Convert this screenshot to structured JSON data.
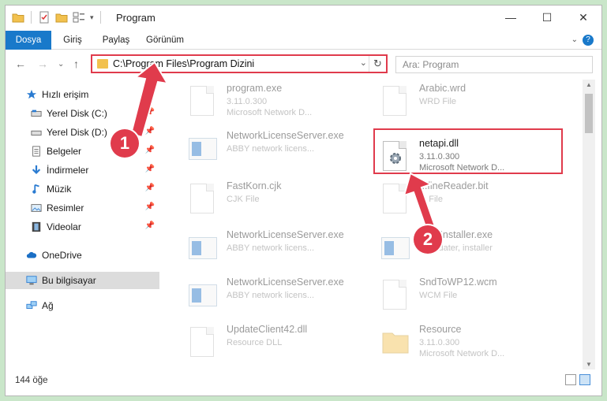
{
  "window": {
    "title": "Program"
  },
  "ribbon": {
    "tabs": [
      "Dosya",
      "Giriş",
      "Paylaş",
      "Görünüm"
    ],
    "help": "?"
  },
  "address": {
    "path": "C:\\Program Files\\Program Dizini",
    "search_placeholder": "Ara: Program"
  },
  "nav": {
    "quick_access": "Hızlı erişim",
    "items": [
      {
        "label": "Yerel Disk (C:)"
      },
      {
        "label": "Yerel Disk (D:)"
      },
      {
        "label": "Belgeler"
      },
      {
        "label": "İndirmeler"
      },
      {
        "label": "Müzik"
      },
      {
        "label": "Resimler"
      },
      {
        "label": "Videolar"
      }
    ],
    "onedrive": "OneDrive",
    "this_pc": "Bu bilgisayar",
    "network": "Ağ"
  },
  "files": [
    {
      "name": "program.exe",
      "line2": "3.11.0.300",
      "line3": "Microsoft Network D...",
      "kind": "exe"
    },
    {
      "name": "Arabic.wrd",
      "line2": "WRD File",
      "line3": "",
      "kind": "doc"
    },
    {
      "name": "NetworkLicenseServer.exe",
      "line2": "ABBY network licens...",
      "line3": "",
      "kind": "app"
    },
    {
      "name": "netapi.dll",
      "line2": "3.11.0.300",
      "line3": "Microsoft Network D...",
      "kind": "dll"
    },
    {
      "name": "FastKorn.cjk",
      "line2": "CJK File",
      "line3": "",
      "kind": "doc"
    },
    {
      "name": "...fineReader.bit",
      "line2": "... File",
      "line3": "",
      "kind": "doc"
    },
    {
      "name": "NetworkLicenseServer.exe",
      "line2": "ABBY network licens...",
      "line3": "",
      "kind": "app"
    },
    {
      "name": "...tallInstaller.exe",
      "line2": "... updater, installer",
      "line3": "",
      "kind": "app"
    },
    {
      "name": "NetworkLicenseServer.exe",
      "line2": "ABBY network licens...",
      "line3": "",
      "kind": "app"
    },
    {
      "name": "SndToWP12.wcm",
      "line2": "WCM File",
      "line3": "",
      "kind": "doc"
    },
    {
      "name": "UpdateClient42.dll",
      "line2": "Resource DLL",
      "line3": "",
      "kind": "dll"
    },
    {
      "name": "Resource",
      "line2": "3.11.0.300",
      "line3": "Microsoft Network D...",
      "kind": "folder"
    }
  ],
  "status": {
    "count": "144 öğe"
  },
  "annotations": {
    "badge1": "1",
    "badge2": "2",
    "color": "#e03b4c"
  }
}
